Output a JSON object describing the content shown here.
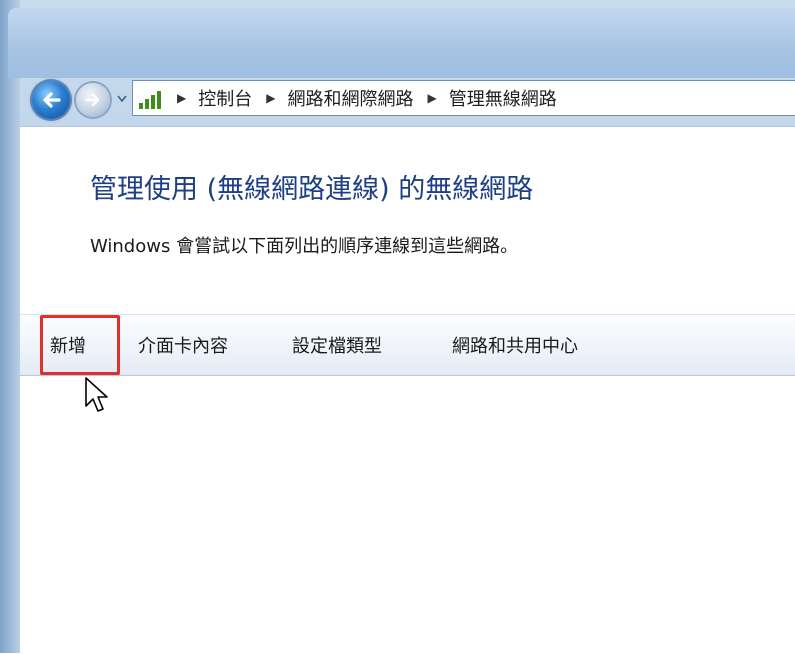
{
  "window": {
    "breadcrumb": [
      "控制台",
      "網路和網際網路",
      "管理無線網路"
    ]
  },
  "main": {
    "heading": "管理使用 (無線網路連線) 的無線網路",
    "description": "Windows 會嘗試以下面列出的順序連線到這些網路。"
  },
  "toolbar": {
    "add_label": "新增",
    "adapter_properties_label": "介面卡內容",
    "profile_types_label": "設定檔類型",
    "network_center_label": "網路和共用中心"
  },
  "icons": {
    "back": "back-arrow-icon",
    "forward": "forward-arrow-icon",
    "dropdown": "chevron-down-icon",
    "location": "network-signal-icon",
    "separator": "chevron-right-icon",
    "cursor": "mouse-pointer-icon"
  },
  "colors": {
    "heading": "#1e3f84",
    "highlight_box": "#e0302c",
    "back_button": "#2b7fd0"
  }
}
